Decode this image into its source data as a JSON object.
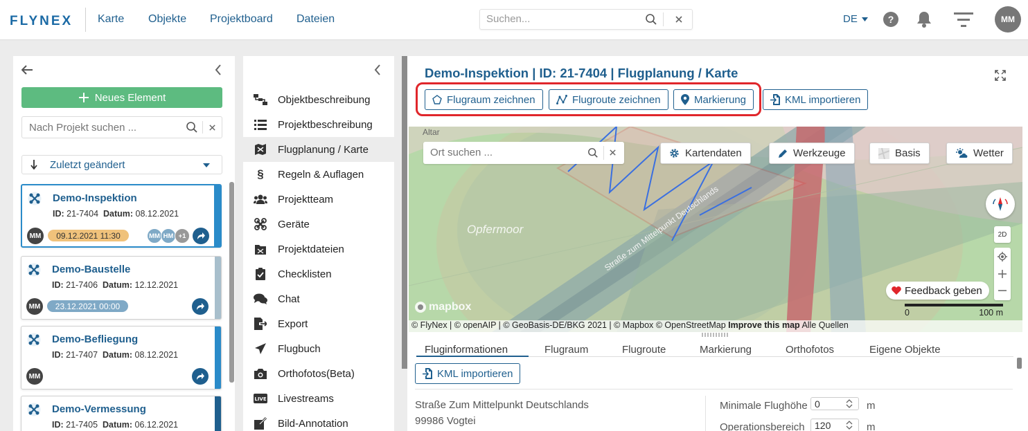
{
  "header": {
    "logo": "FLYNEX",
    "nav": [
      "Karte",
      "Objekte",
      "Projektboard",
      "Dateien"
    ],
    "search_placeholder": "Suchen...",
    "language": "DE",
    "user_initials": "MM"
  },
  "left_panel": {
    "new_element_label": "Neues Element",
    "project_search_placeholder": "Nach Projekt suchen ...",
    "sort_label": "Zuletzt geändert",
    "projects": [
      {
        "title": "Demo-Inspektion",
        "id_label": "ID:",
        "id": "21-7404",
        "date_label": "Datum:",
        "date": "08.12.2021",
        "avatar": "MM",
        "badge": "09.12.2021 11:30",
        "badge_color": "#f0c27b",
        "bar_color": "#2a8bc9",
        "members": [
          "MM",
          "HM",
          "+1"
        ]
      },
      {
        "title": "Demo-Baustelle",
        "id_label": "ID:",
        "id": "21-7406",
        "date_label": "Datum:",
        "date": "12.12.2021",
        "avatar": "MM",
        "badge": "23.12.2021 00:00",
        "badge_color": "#7fa9c6",
        "bar_color": "#a8bfcc"
      },
      {
        "title": "Demo-Befliegung",
        "id_label": "ID:",
        "id": "21-7407",
        "date_label": "Datum:",
        "date": "08.12.2021",
        "avatar": "MM",
        "bar_color": "#2a8bc9"
      },
      {
        "title": "Demo-Vermessung",
        "id_label": "ID:",
        "id": "21-7405",
        "date_label": "Datum:",
        "date": "06.12.2021",
        "bar_color": "#1f5f8e"
      }
    ]
  },
  "menu": {
    "items": [
      {
        "label": "Objektbeschreibung",
        "icon": "sitemap-icon"
      },
      {
        "label": "Projektbeschreibung",
        "icon": "list-icon"
      },
      {
        "label": "Flugplanung / Karte",
        "icon": "map-drone-icon",
        "active": true
      },
      {
        "label": "Regeln & Auflagen",
        "icon": "paragraph-icon"
      },
      {
        "label": "Projektteam",
        "icon": "users-icon"
      },
      {
        "label": "Geräte",
        "icon": "drone-icon"
      },
      {
        "label": "Projektdateien",
        "icon": "folder-icon"
      },
      {
        "label": "Checklisten",
        "icon": "clipboard-check-icon"
      },
      {
        "label": "Chat",
        "icon": "chat-icon"
      },
      {
        "label": "Export",
        "icon": "export-icon"
      },
      {
        "label": "Flugbuch",
        "icon": "plane-icon"
      },
      {
        "label": "Orthofotos(Beta)",
        "icon": "camera-icon"
      },
      {
        "label": "Livestreams",
        "icon": "live-icon"
      },
      {
        "label": "Bild-Annotation",
        "icon": "annotation-icon"
      }
    ]
  },
  "main": {
    "title": "Demo-Inspektion | ID: 21-7404 | Flugplanung / Karte",
    "toolbar": {
      "flugraum": "Flugraum zeichnen",
      "flugroute": "Flugroute zeichnen",
      "markierung": "Markierung",
      "kml": "KML importieren"
    },
    "map": {
      "place_search_placeholder": "Ort suchen ...",
      "kartendaten": "Kartendaten",
      "werkzeuge": "Werkzeuge",
      "basis": "Basis",
      "wetter": "Wetter",
      "mode_2d": "2D",
      "feedback": "Feedback geben",
      "scale_start": "0",
      "scale_end": "100 m",
      "place_opfermoor": "Opfermoor",
      "place_altar": "Altar",
      "road_label": "Straße zum Mittelpunkt Deutschlands",
      "mapbox_logo": "mapbox",
      "attribution": "© FlyNex | © openAIP | © GeoBasis-DE/BKG 2021 | © Mapbox © OpenStreetMap",
      "improve": "Improve this map",
      "sources": "Alle Quellen"
    },
    "tabs": [
      "Fluginformationen",
      "Flugraum",
      "Flugroute",
      "Markierung",
      "Orthofotos",
      "Eigene Objekte"
    ],
    "kml_button": "KML importieren",
    "address_line1": "Straße Zum Mittelpunkt Deutschlands",
    "address_line2": "99986 Vogtei",
    "min_height_label": "Minimale Flughöhe",
    "min_height_value": "0",
    "min_height_unit": "m",
    "op_area_label": "Operationsbereich",
    "op_area_value": "120",
    "op_area_unit": "m"
  },
  "colors": {
    "primary": "#1f5f8e",
    "green": "#5dbb80",
    "highlight": "#e0262b"
  }
}
